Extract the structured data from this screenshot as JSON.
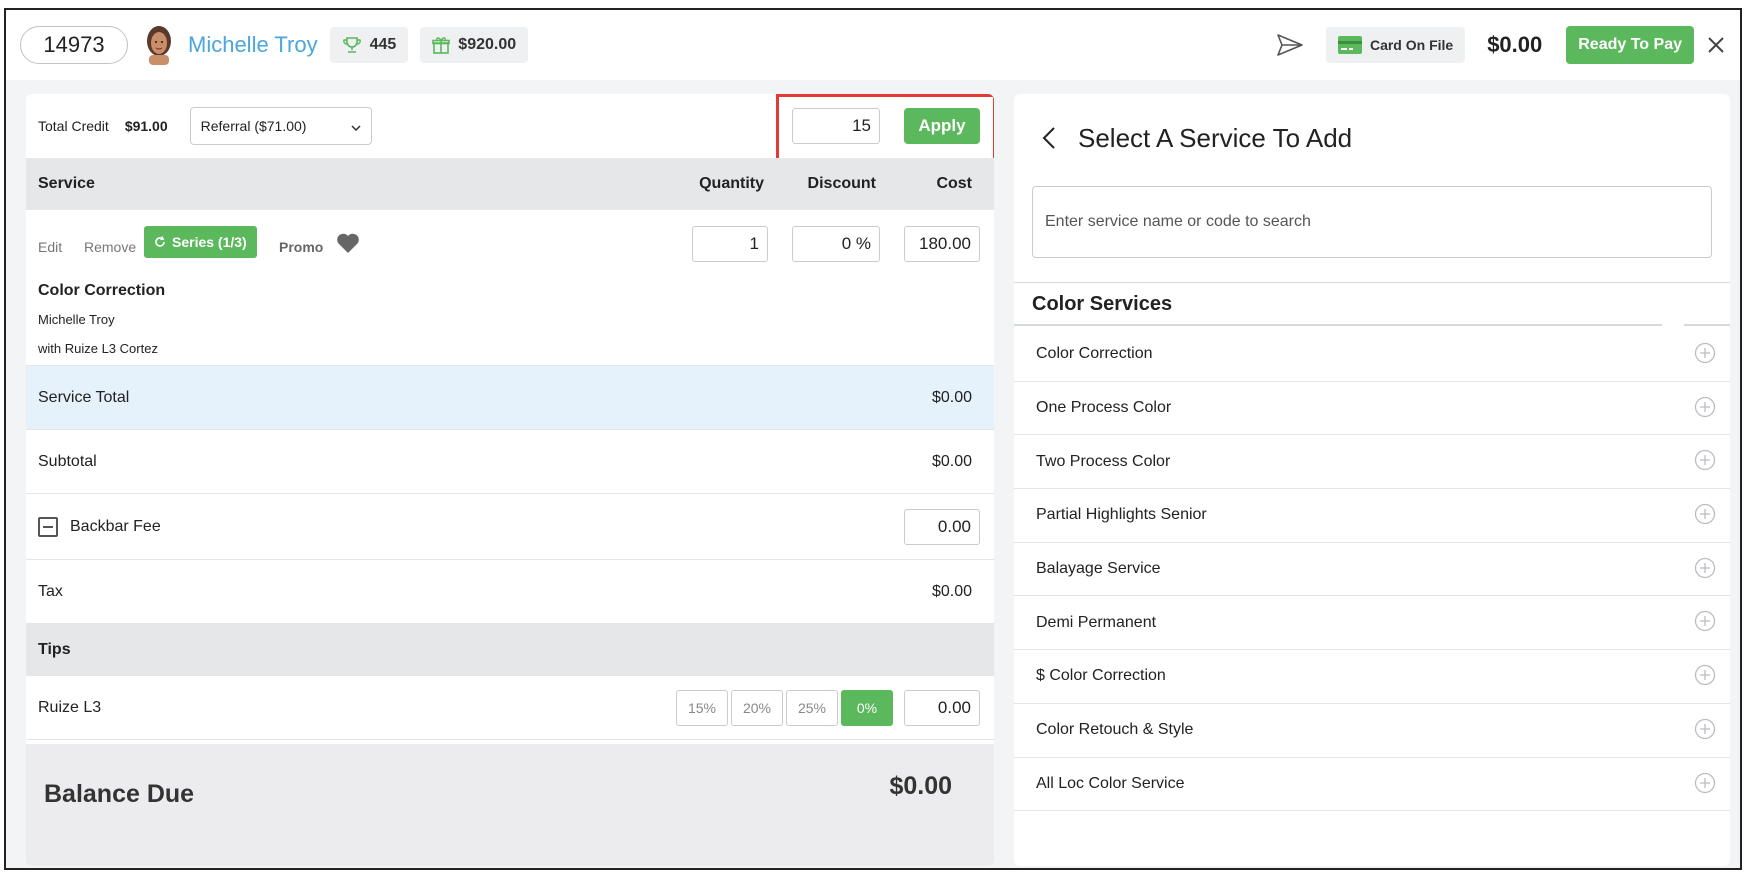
{
  "header": {
    "ticket_number": "14973",
    "client_name": "Michelle Troy",
    "loyalty_points": "445",
    "gift_balance": "$920.00",
    "card_on_file_label": "Card On File",
    "total": "$0.00",
    "ready_to_pay_label": "Ready To Pay",
    "icons": [
      "trophy-icon",
      "gift-icon",
      "send-icon",
      "credit-card-icon",
      "close-icon"
    ],
    "accent_color": "#5cb85c",
    "name_color": "#4aa6dd"
  },
  "credit": {
    "label": "Total Credit",
    "amount": "$91.00",
    "selected_referral": "Referral ($71.00)",
    "discount_value": "15",
    "apply_label": "Apply",
    "highlight_color": "#e53935"
  },
  "service_table": {
    "headers": {
      "service": "Service",
      "quantity": "Quantity",
      "discount": "Discount",
      "cost": "Cost"
    },
    "item": {
      "edit_label": "Edit",
      "remove_label": "Remove",
      "series_label": "Series (1/3)",
      "promo_label": "Promo",
      "quantity": "1",
      "discount": "0 %",
      "cost": "180.00",
      "name": "Color Correction",
      "client": "Michelle Troy",
      "staff": "with Ruize L3 Cortez"
    }
  },
  "totals": {
    "service_total_label": "Service Total",
    "service_total_value": "$0.00",
    "subtotal_label": "Subtotal",
    "subtotal_value": "$0.00",
    "backbar_label": "Backbar Fee",
    "backbar_value": "0.00",
    "tax_label": "Tax",
    "tax_value": "$0.00"
  },
  "tips": {
    "header": "Tips",
    "staff": "Ruize L3",
    "options": [
      "15%",
      "20%",
      "25%",
      "0%"
    ],
    "selected_option": "0%",
    "amount": "0.00"
  },
  "balance": {
    "label": "Balance Due",
    "value": "$0.00"
  },
  "service_picker": {
    "title": "Select A Service To Add",
    "search_placeholder": "Enter service name or code to search",
    "category": "Color Services",
    "services": [
      "Color Correction",
      "One Process Color",
      "Two Process Color",
      "Partial Highlights Senior",
      "Balayage Service",
      "Demi Permanent",
      "$ Color Correction",
      "Color Retouch & Style",
      "All Loc Color Service"
    ]
  }
}
